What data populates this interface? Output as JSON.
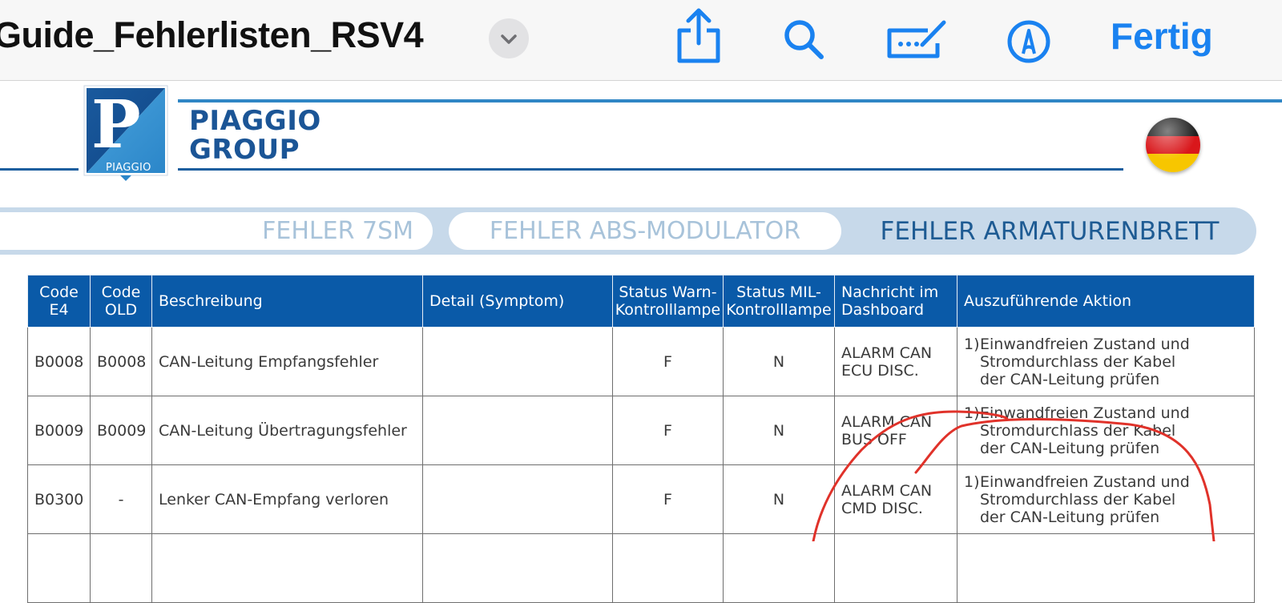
{
  "toolbar": {
    "title": "Guide_Fehlerlisten_RSV4",
    "done_label": "Fertig",
    "icons": [
      "chevron-down-icon",
      "share-icon",
      "search-icon",
      "markup-icon",
      "pencil-circle-icon"
    ],
    "accent_color": "#1a82f0"
  },
  "header": {
    "logo_badge_text": "PIAGGIO",
    "brand_line1": "PIAGGIO",
    "brand_line2": "GROUP",
    "brand_color": "#1b5596",
    "flag": "germany-flag"
  },
  "tabs": [
    {
      "label": "FEHLER 7SM",
      "active": false
    },
    {
      "label": "FEHLER ABS-MODULATOR",
      "active": false
    },
    {
      "label": "FEHLER ARMATURENBRETT",
      "active": true
    }
  ],
  "table": {
    "headers": {
      "code_e4": "Code E4",
      "code_old": "Code OLD",
      "beschreibung": "Beschreibung",
      "detail": "Detail (Symptom)",
      "status_warn": "Status Warn-Kontrolllampe",
      "status_mil": "Status MIL-Kontrolllampe",
      "nachricht": "Nachricht im Dashboard",
      "aktion": "Auszuführende Aktion"
    },
    "rows": [
      {
        "code_e4": "B0008",
        "code_old": "B0008",
        "beschreibung": "CAN-Leitung Empfangsfehler",
        "detail": "",
        "status_warn": "F",
        "status_mil": "N",
        "nachricht": "ALARM CAN ECU DISC.",
        "aktion_num": "1)",
        "aktion": "Einwandfreien Zustand und Stromdurchlass der Kabel der CAN-Leitung prüfen"
      },
      {
        "code_e4": "B0009",
        "code_old": "B0009",
        "beschreibung": "CAN-Leitung Übertragungsfehler",
        "detail": "",
        "status_warn": "F",
        "status_mil": "N",
        "nachricht": "ALARM CAN BUS OFF",
        "aktion_num": "1)",
        "aktion": "Einwandfreien Zustand und Stromdurchlass der Kabel der CAN-Leitung prüfen"
      },
      {
        "code_e4": "B0300",
        "code_old": "-",
        "beschreibung": "Lenker CAN-Empfang verloren",
        "detail": "",
        "status_warn": "F",
        "status_mil": "N",
        "nachricht": "ALARM CAN CMD DISC.",
        "aktion_num": "1)",
        "aktion": "Einwandfreien Zustand und Stromdurchlass der Kabel der CAN-Leitung prüfen"
      }
    ]
  },
  "annotation": {
    "type": "red-hand-drawn-line",
    "color": "#e0322a"
  }
}
